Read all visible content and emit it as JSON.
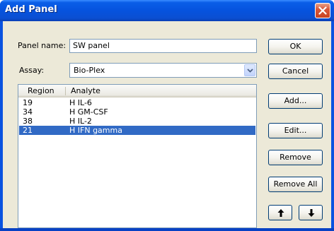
{
  "window": {
    "title": "Add Panel"
  },
  "form": {
    "panel_name_label": "Panel name:",
    "panel_name_value": "SW panel",
    "assay_label": "Assay:",
    "assay_value": "Bio-Plex"
  },
  "list": {
    "columns": [
      "Region",
      "Analyte"
    ],
    "rows": [
      {
        "region": "19",
        "analyte": "H IL-6",
        "selected": false
      },
      {
        "region": "34",
        "analyte": "H GM-CSF",
        "selected": false
      },
      {
        "region": "38",
        "analyte": "H IL-2",
        "selected": false
      },
      {
        "region": "21",
        "analyte": "H IFN gamma",
        "selected": true
      }
    ]
  },
  "buttons": {
    "ok": "OK",
    "cancel": "Cancel",
    "add": "Add...",
    "edit": "Edit...",
    "remove": "Remove",
    "remove_all": "Remove All"
  },
  "icons": {
    "close": "close-icon",
    "dropdown": "chevron-down-icon",
    "move_up": "arrow-up-icon",
    "move_down": "arrow-down-icon"
  },
  "colors": {
    "title_bar": "#0653de",
    "dialog_bg": "#ece9d8",
    "selection": "#316ac5",
    "close_button": "#d9573a"
  }
}
